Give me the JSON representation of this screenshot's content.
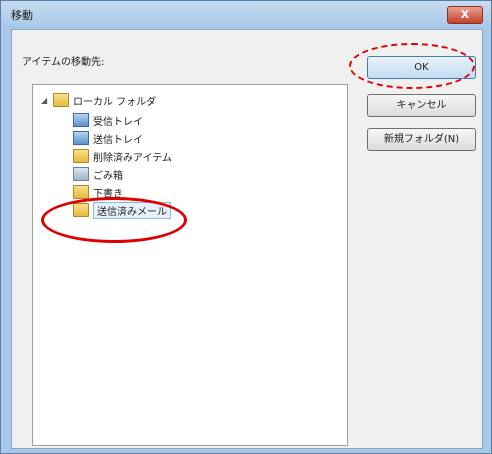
{
  "window": {
    "title": "移動",
    "close_label": "X"
  },
  "dialog": {
    "prompt": "アイテムの移動先:"
  },
  "tree": {
    "root": {
      "label": "ローカル フォルダ",
      "expander": "◢"
    },
    "items": [
      {
        "label": "受信トレイ",
        "icon": "inbox-folder-icon"
      },
      {
        "label": "送信トレイ",
        "icon": "outbox-folder-icon"
      },
      {
        "label": "削除済みアイテム",
        "icon": "deleted-items-folder-icon"
      },
      {
        "label": "ごみ箱",
        "icon": "trash-icon"
      },
      {
        "label": "下書き",
        "icon": "drafts-folder-icon"
      },
      {
        "label": "送信済みメール",
        "icon": "sent-mail-folder-icon",
        "selected": true
      }
    ]
  },
  "buttons": {
    "ok": "OK",
    "cancel": "キャンセル",
    "new_folder": "新規フォルダ(N)"
  },
  "colors": {
    "annotation": "#e00000",
    "window_frame": "#a9c8e8"
  }
}
